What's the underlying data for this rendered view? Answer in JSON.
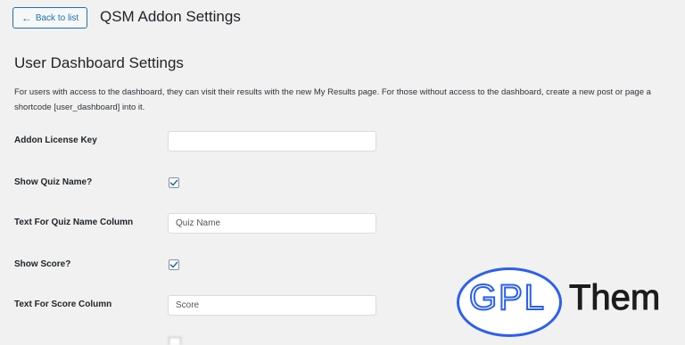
{
  "header": {
    "back_label": "Back to list",
    "title": "QSM Addon Settings"
  },
  "section": {
    "title": "User Dashboard Settings",
    "description_line1": "For users with access to the dashboard, they can visit their results with the new My Results page. For those without access to the dashboard, create a new post or page a",
    "description_line2": "shortcode [user_dashboard] into it."
  },
  "fields": {
    "license_key": {
      "label": "Addon License Key",
      "value": ""
    },
    "show_quiz_name": {
      "label": "Show Quiz Name?",
      "checked": true
    },
    "quiz_name_column": {
      "label": "Text For Quiz Name Column",
      "value": "Quiz Name"
    },
    "show_score": {
      "label": "Show Score?",
      "checked": true
    },
    "score_column": {
      "label": "Text For Score Column",
      "value": "Score"
    }
  },
  "watermark": {
    "logo_text": "GPL",
    "suffix_text": "Them"
  },
  "colors": {
    "accent": "#2271b1",
    "background": "#f1f1f1",
    "watermark_blue": "#2a5ff0"
  },
  "icons": {
    "back": "arrow-left-icon",
    "checkbox": "checkmark-icon"
  }
}
